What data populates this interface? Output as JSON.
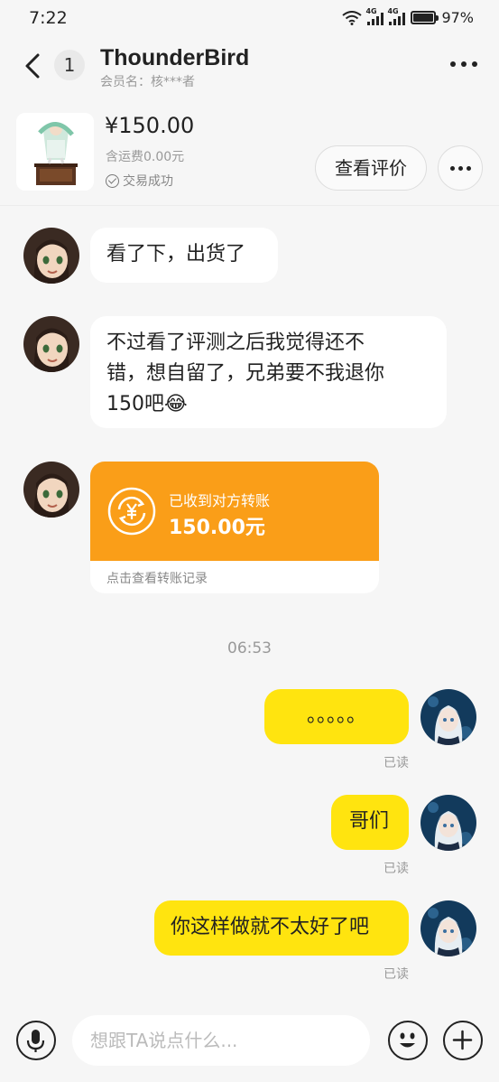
{
  "status_bar": {
    "time": "7:22",
    "net1": "4G",
    "net2": "4G",
    "battery": "97%",
    "battery_level": 0.97
  },
  "header": {
    "unread_count": "1",
    "title": "ThounderBird",
    "subtitle": "会员名：核***者"
  },
  "product": {
    "price": "¥150.00",
    "shipping": "含运费0.00元",
    "deal_status": "交易成功",
    "review_button": "查看评价"
  },
  "messages": [
    {
      "side": "in",
      "text": "看了下，出货了"
    },
    {
      "side": "in",
      "lines": [
        "不过看了评测之后我觉得还不",
        "错，想自留了，兄弟要不我退你",
        "150吧"
      ],
      "emoji": "😂"
    },
    {
      "side": "in",
      "type": "transfer",
      "label": "已收到对方转账",
      "amount": "150.00元",
      "footer": "点击查看转账记录"
    },
    {
      "type": "timestamp",
      "text": "06:53"
    },
    {
      "side": "out",
      "text": "。。。。。",
      "read": "已读"
    },
    {
      "side": "out",
      "text": "哥们",
      "read": "已读"
    },
    {
      "side": "out",
      "text": "你这样做就不太好了吧",
      "read": "已读"
    }
  ],
  "input_bar": {
    "placeholder": "想跟TA说点什么..."
  },
  "colors": {
    "accent_yellow": "#ffe40f",
    "transfer_orange": "#fa9e18",
    "background": "#f6f6f6"
  }
}
